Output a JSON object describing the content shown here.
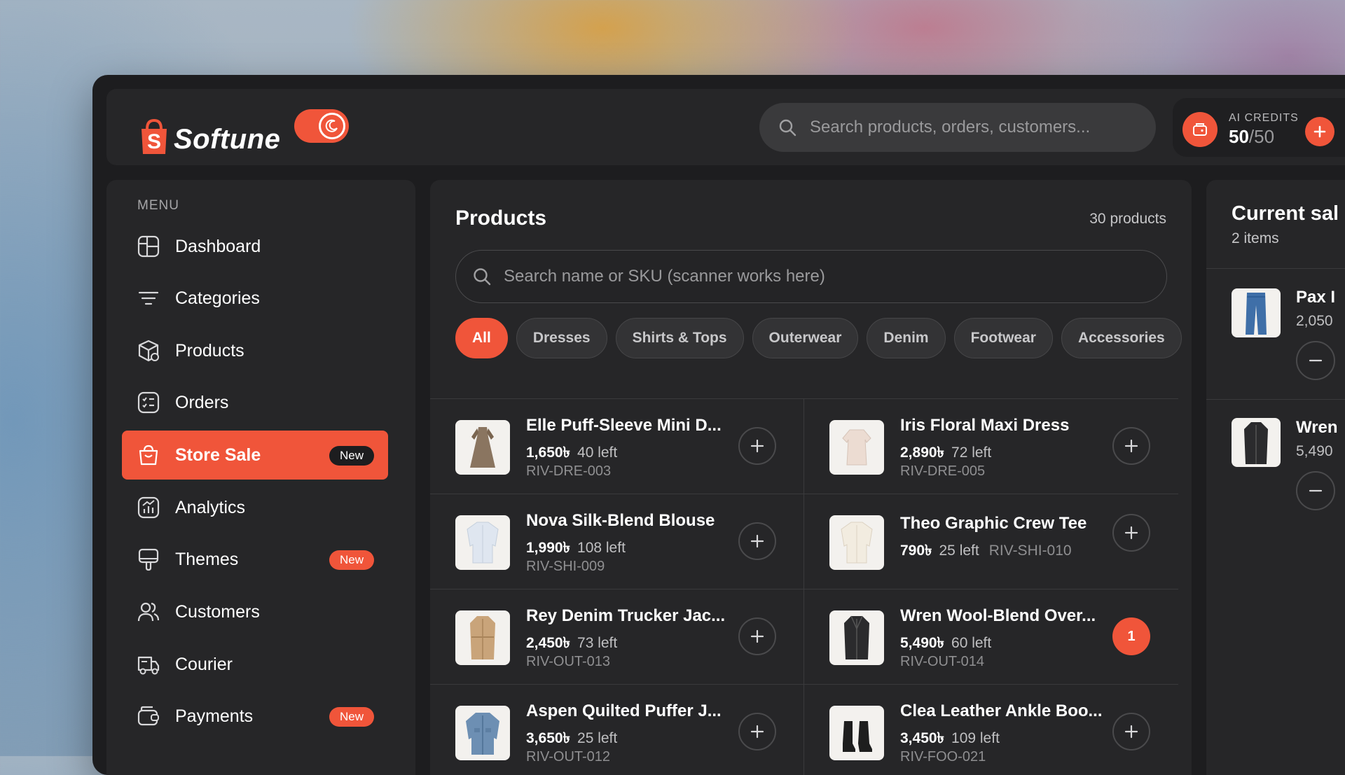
{
  "colors": {
    "accent": "#f0553a",
    "panel": "#262628",
    "window": "#1d1d1f"
  },
  "header": {
    "brand": "Softune",
    "search_placeholder": "Search products, orders, customers...",
    "credits": {
      "label": "AI CREDITS",
      "used": "50",
      "max": "/50"
    }
  },
  "sidebar": {
    "menu_title": "MENU",
    "items": [
      {
        "label": "Dashboard",
        "icon": "dashboard-icon"
      },
      {
        "label": "Categories",
        "icon": "filter-icon"
      },
      {
        "label": "Products",
        "icon": "box-icon"
      },
      {
        "label": "Orders",
        "icon": "orders-icon"
      },
      {
        "label": "Store Sale",
        "icon": "shopping-bag-icon",
        "badge": "New",
        "active": true
      },
      {
        "label": "Analytics",
        "icon": "analytics-icon"
      },
      {
        "label": "Themes",
        "icon": "brush-icon",
        "badge": "New"
      },
      {
        "label": "Customers",
        "icon": "users-icon"
      },
      {
        "label": "Courier",
        "icon": "truck-icon"
      },
      {
        "label": "Payments",
        "icon": "wallet-icon",
        "badge": "New"
      }
    ]
  },
  "products": {
    "title": "Products",
    "count": "30 products",
    "search_placeholder": "Search name or SKU (scanner works here)",
    "filters": [
      "All",
      "Dresses",
      "Shirts & Tops",
      "Outerwear",
      "Denim",
      "Footwear",
      "Accessories"
    ],
    "items": [
      {
        "name": "Elle Puff-Sleeve Mini D...",
        "price": "1,650৳",
        "stock": "40 left",
        "sku": "RIV-DRE-003",
        "image": "dress-icon"
      },
      {
        "name": "Iris Floral Maxi Dress",
        "price": "2,890৳",
        "stock": "72 left",
        "sku": "RIV-DRE-005",
        "image": "blouse-icon"
      },
      {
        "name": "Nova Silk-Blend Blouse",
        "price": "1,990৳",
        "stock": "108 left",
        "sku": "RIV-SHI-009",
        "image": "shirt-icon"
      },
      {
        "name": "Theo Graphic Crew Tee",
        "price": "790৳",
        "stock": "25 left",
        "sku": "RIV-SHI-010",
        "image": "shirt-icon"
      },
      {
        "name": "Rey Denim Trucker Jac...",
        "price": "2,450৳",
        "stock": "73 left",
        "sku": "RIV-OUT-013",
        "image": "trench-coat-icon"
      },
      {
        "name": "Wren Wool-Blend Over...",
        "price": "5,490৳",
        "stock": "60 left",
        "sku": "RIV-OUT-014",
        "image": "coat-icon",
        "qty": "1"
      },
      {
        "name": "Aspen Quilted Puffer J...",
        "price": "3,650৳",
        "stock": "25 left",
        "sku": "RIV-OUT-012",
        "image": "jacket-icon"
      },
      {
        "name": "Clea Leather Ankle Boo...",
        "price": "3,450৳",
        "stock": "109 left",
        "sku": "RIV-FOO-021",
        "image": "boots-icon"
      }
    ]
  },
  "current_sale": {
    "title": "Current sal",
    "items_count": "2 items",
    "items": [
      {
        "name": "Pax I",
        "price": "2,050",
        "image": "jeans-icon"
      },
      {
        "name": "Wren",
        "price": "5,490",
        "image": "coat-icon"
      }
    ]
  }
}
